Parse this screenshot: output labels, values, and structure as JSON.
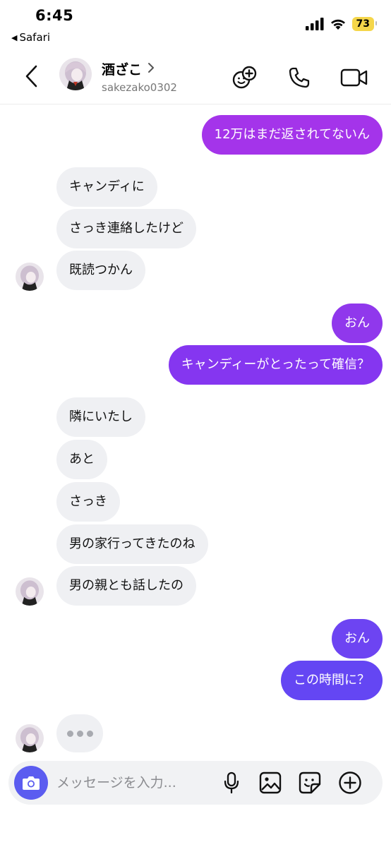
{
  "status_bar": {
    "time": "6:45",
    "back_app": "Safari",
    "battery": "73"
  },
  "header": {
    "name": "酒ざこ",
    "handle": "sakezako0302"
  },
  "messages": [
    {
      "side": "me",
      "text": "12万はまだ返されてないん"
    },
    {
      "side": "them",
      "text": "キャンディに"
    },
    {
      "side": "them",
      "text": "さっき連絡したけど"
    },
    {
      "side": "them",
      "text": "既読つかん"
    },
    {
      "side": "me",
      "text": "おん"
    },
    {
      "side": "me",
      "text": "キャンディーがとったって確信？"
    },
    {
      "side": "them",
      "text": "隣にいたし"
    },
    {
      "side": "them",
      "text": "あと"
    },
    {
      "side": "them",
      "text": "さっき"
    },
    {
      "side": "them",
      "text": "男の家行ってきたのね"
    },
    {
      "side": "them",
      "text": "男の親とも話したの"
    },
    {
      "side": "me",
      "text": "おん"
    },
    {
      "side": "me",
      "text": "この時間に？"
    }
  ],
  "composer": {
    "placeholder": "メッセージを入力..."
  },
  "colors": {
    "bubble_purple": "#a434ea",
    "bubble_violet": "#8536f0",
    "bubble_indigo": "#6446f3",
    "camera_button": "#5b5cf0",
    "incoming_bubble": "#eff0f3"
  },
  "icons": [
    "back-chevron-icon",
    "add-people-icon",
    "phone-icon",
    "video-camera-icon",
    "camera-icon",
    "microphone-icon",
    "gallery-icon",
    "sticker-icon",
    "plus-circle-icon"
  ]
}
